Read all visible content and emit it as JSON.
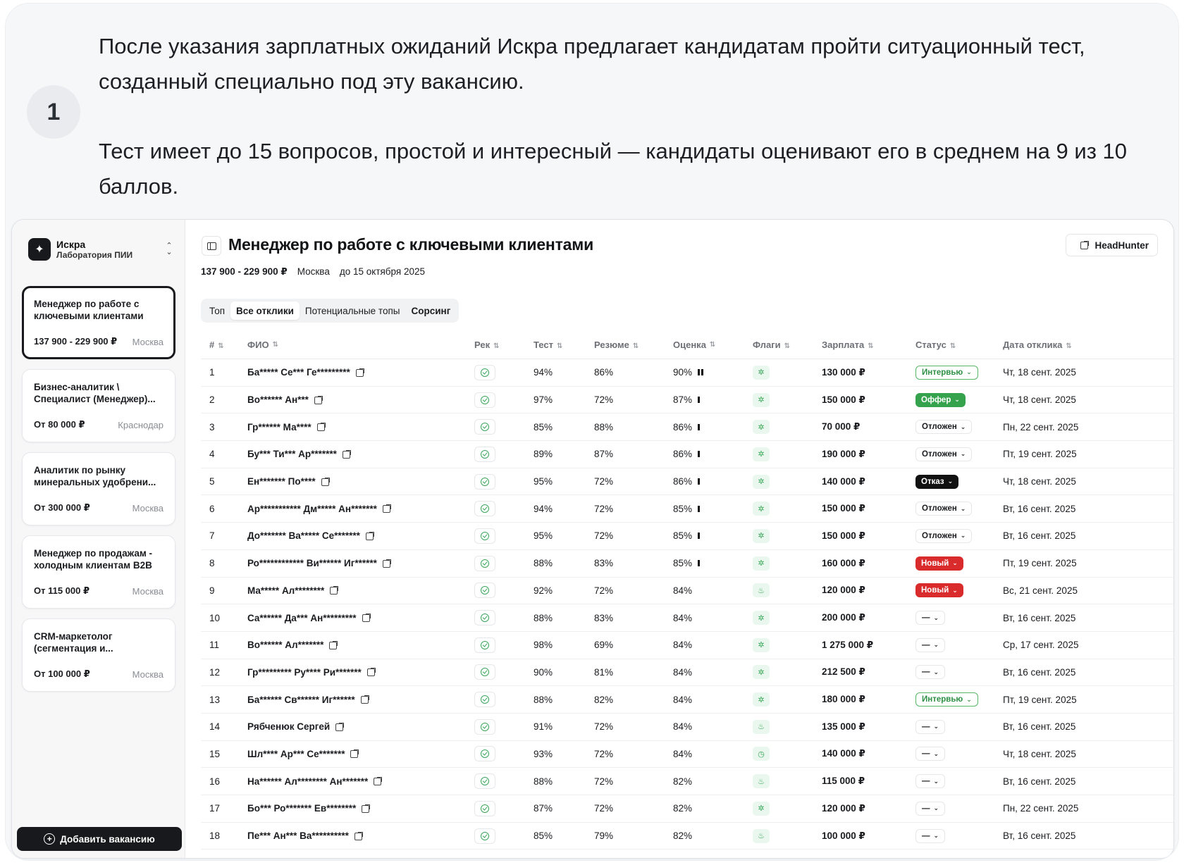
{
  "intro": {
    "step": "1",
    "p1": "После указания зарплатных ожиданий Искра предлагает кандидатам пройти ситуационный тест, созданный специально под эту вакансию.",
    "p2": "Тест имеет до 15 вопросов, простой и интересный — кандидаты оценивают его в среднем на 9 из 10 баллов."
  },
  "sidebar": {
    "org_name": "Искра",
    "org_sub": "Лаборатория ПИИ",
    "vacancies": [
      {
        "title": "Менеджер по работе с ключевыми клиентами",
        "salary": "137 900 - 229 900 ₽",
        "city": "Москва"
      },
      {
        "title": "Бизнес-аналитик \\ Специалист (Менеджер)...",
        "salary": "От 80 000 ₽",
        "city": "Краснодар"
      },
      {
        "title": "Аналитик по рынку минеральных удобрени...",
        "salary": "От 300 000 ₽",
        "city": "Москва"
      },
      {
        "title": "Менеджер по продажам - холодным клиентам B2B",
        "salary": "От 115 000 ₽",
        "city": "Москва"
      },
      {
        "title": "CRM-маркетолог (сегментация и...",
        "salary": "От 100 000 ₽",
        "city": "Москва"
      }
    ],
    "add_button": "Добавить вакансию"
  },
  "main": {
    "title": "Менеджер по работе с ключевыми клиентами",
    "hh_button": "HeadHunter",
    "meta": {
      "salary": "137 900 - 229 900 ₽",
      "city": "Москва",
      "deadline": "до 15 октября 2025"
    },
    "tabs": [
      "Топ",
      "Все отклики",
      "Потенциальные топы",
      "Сорсинг"
    ],
    "columns": [
      "#",
      "ФИО",
      "Рек",
      "Тест",
      "Резюме",
      "Оценка",
      "Флаги",
      "Зарплата",
      "Статус",
      "Дата отклика"
    ],
    "rows": [
      {
        "n": "1",
        "fio": "Ба***** Се*** Ге*********",
        "test": "94%",
        "res": "86%",
        "score": "90%",
        "bars": 2,
        "flag": "sparkle-icon",
        "sal": "130 000 ₽",
        "status": "Интервью",
        "stype": "interview",
        "date": "Чт, 18 сент. 2025"
      },
      {
        "n": "2",
        "fio": "Во****** Ан***",
        "test": "97%",
        "res": "72%",
        "score": "87%",
        "bars": 1,
        "flag": "sparkle-icon",
        "sal": "150 000 ₽",
        "status": "Оффер",
        "stype": "offer",
        "date": "Чт, 18 сент. 2025"
      },
      {
        "n": "3",
        "fio": "Гр****** Ма****",
        "test": "85%",
        "res": "88%",
        "score": "86%",
        "bars": 1,
        "flag": "sparkle-icon",
        "sal": "70 000 ₽",
        "status": "Отложен",
        "stype": "postponed",
        "date": "Пн, 22 сент. 2025"
      },
      {
        "n": "4",
        "fio": "Бу*** Ти*** Ар*******",
        "test": "89%",
        "res": "87%",
        "score": "86%",
        "bars": 1,
        "flag": "sparkle-icon",
        "sal": "190 000 ₽",
        "status": "Отложен",
        "stype": "postponed",
        "date": "Пт, 19 сент. 2025"
      },
      {
        "n": "5",
        "fio": "Ен******* По****",
        "test": "95%",
        "res": "72%",
        "score": "86%",
        "bars": 1,
        "flag": "sparkle-icon",
        "sal": "140 000 ₽",
        "status": "Отказ",
        "stype": "reject",
        "date": "Чт, 18 сент. 2025"
      },
      {
        "n": "6",
        "fio": "Ар*********** Дм***** Ан*******",
        "test": "94%",
        "res": "72%",
        "score": "85%",
        "bars": 1,
        "flag": "sparkle-icon",
        "sal": "150 000 ₽",
        "status": "Отложен",
        "stype": "postponed",
        "date": "Вт, 16 сент. 2025"
      },
      {
        "n": "7",
        "fio": "До******* Ва***** Се*******",
        "test": "95%",
        "res": "72%",
        "score": "85%",
        "bars": 1,
        "flag": "sparkle-icon",
        "sal": "150 000 ₽",
        "status": "Отложен",
        "stype": "postponed",
        "date": "Вт, 16 сент. 2025"
      },
      {
        "n": "8",
        "fio": "Ро************ Ви****** Иг******",
        "test": "88%",
        "res": "83%",
        "score": "85%",
        "bars": 1,
        "flag": "sparkle-icon",
        "sal": "160 000 ₽",
        "status": "Новый",
        "stype": "new",
        "date": "Пт, 19 сент. 2025"
      },
      {
        "n": "9",
        "fio": "Ма***** Ал********",
        "test": "92%",
        "res": "72%",
        "score": "84%",
        "bars": 0,
        "flag": "fire-icon",
        "sal": "120 000 ₽",
        "status": "Новый",
        "stype": "new",
        "date": "Вс, 21 сент. 2025"
      },
      {
        "n": "10",
        "fio": "Са****** Да*** Ан*********",
        "test": "88%",
        "res": "83%",
        "score": "84%",
        "bars": 0,
        "flag": "sparkle-icon",
        "sal": "200 000 ₽",
        "status": "—",
        "stype": "none",
        "date": "Вт, 16 сент. 2025"
      },
      {
        "n": "11",
        "fio": "Во****** Ал*******",
        "test": "98%",
        "res": "69%",
        "score": "84%",
        "bars": 0,
        "flag": "sparkle-icon",
        "sal": "1 275 000 ₽",
        "status": "—",
        "stype": "none",
        "date": "Ср, 17 сент. 2025"
      },
      {
        "n": "12",
        "fio": "Гр********* Ру**** Ри*******",
        "test": "90%",
        "res": "81%",
        "score": "84%",
        "bars": 0,
        "flag": "sparkle-icon",
        "sal": "212 500 ₽",
        "status": "—",
        "stype": "none",
        "date": "Вт, 16 сент. 2025"
      },
      {
        "n": "13",
        "fio": "Ба****** Св****** Иг******",
        "test": "88%",
        "res": "82%",
        "score": "84%",
        "bars": 0,
        "flag": "sparkle-icon",
        "sal": "180 000 ₽",
        "status": "Интервью",
        "stype": "interview",
        "date": "Пт, 19 сент. 2025"
      },
      {
        "n": "14",
        "fio": "Рябченюк Сергей",
        "test": "91%",
        "res": "72%",
        "score": "84%",
        "bars": 0,
        "flag": "fire-icon",
        "sal": "135 000 ₽",
        "status": "—",
        "stype": "none",
        "date": "Вт, 16 сент. 2025"
      },
      {
        "n": "15",
        "fio": "Шл**** Ар*** Се*******",
        "test": "93%",
        "res": "72%",
        "score": "84%",
        "bars": 0,
        "flag": "clock-icon",
        "sal": "140 000 ₽",
        "status": "—",
        "stype": "none",
        "date": "Чт, 18 сент. 2025"
      },
      {
        "n": "16",
        "fio": "На****** Ал******** Ан*******",
        "test": "88%",
        "res": "72%",
        "score": "82%",
        "bars": 0,
        "flag": "fire-icon",
        "sal": "115 000 ₽",
        "status": "—",
        "stype": "none",
        "date": "Вт, 16 сент. 2025"
      },
      {
        "n": "17",
        "fio": "Бо*** Ро******* Ев********",
        "test": "87%",
        "res": "72%",
        "score": "82%",
        "bars": 0,
        "flag": "sparkle-icon",
        "sal": "120 000 ₽",
        "status": "—",
        "stype": "none",
        "date": "Пн, 22 сент. 2025"
      },
      {
        "n": "18",
        "fio": "Пе*** Ан*** Ва**********",
        "test": "85%",
        "res": "79%",
        "score": "82%",
        "bars": 0,
        "flag": "fire-icon",
        "sal": "100 000 ₽",
        "status": "—",
        "stype": "none",
        "date": "Вт, 16 сент. 2025"
      }
    ]
  },
  "colors": {
    "accent": "#18191c",
    "green": "#35a24d",
    "red": "#d92b2b"
  }
}
